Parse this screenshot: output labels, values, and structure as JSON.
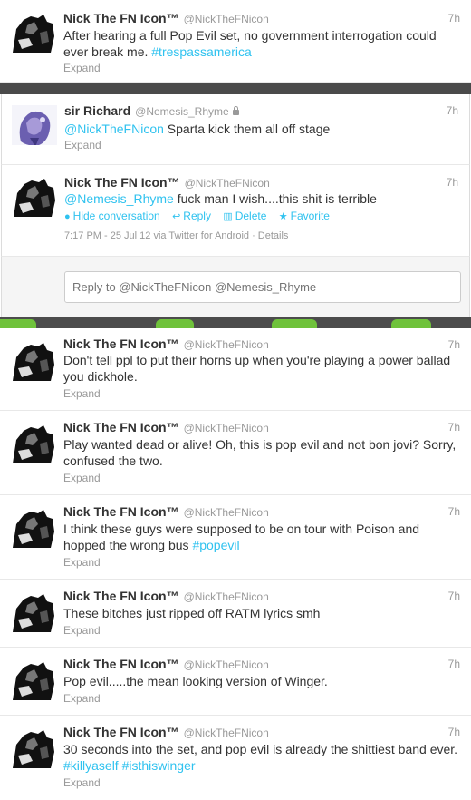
{
  "colors": {
    "link": "#2fc2ef",
    "muted": "#999999",
    "text": "#333333"
  },
  "tweets": [
    {
      "name": "Nick The FN Icon™",
      "handle": "@NickTheFNicon",
      "time": "7h",
      "text": "After hearing a full Pop Evil set, no government interrogation could ever break me. ",
      "tag": "#trespassamerica",
      "expand": "Expand"
    },
    {
      "name": "sir Richard",
      "handle": "@Nemesis_Rhyme",
      "time": "7h",
      "mention": "@NickTheFNicon",
      "text": " Sparta kick them all off stage",
      "expand": "Expand",
      "protected_icon": "lock-icon"
    },
    {
      "name": "Nick The FN Icon™",
      "handle": "@NickTheFNicon",
      "time": "7h",
      "mention": "@Nemesis_Rhyme",
      "text": " fuck man I wish....this shit is terrible",
      "actions": {
        "hide": "Hide conversation",
        "reply": "Reply",
        "delete": "Delete",
        "favorite": "Favorite"
      },
      "meta": "7:17 PM - 25 Jul 12 via Twitter for Android · Details"
    },
    {
      "name": "Nick The FN Icon™",
      "handle": "@NickTheFNicon",
      "time": "7h",
      "text": "Don't tell ppl to put their horns up when you're playing a power ballad you dickhole.",
      "expand": "Expand"
    },
    {
      "name": "Nick The FN Icon™",
      "handle": "@NickTheFNicon",
      "time": "7h",
      "text": "Play wanted dead or alive! Oh, this is pop evil and not bon jovi? Sorry, confused the two.",
      "expand": "Expand"
    },
    {
      "name": "Nick The FN Icon™",
      "handle": "@NickTheFNicon",
      "time": "7h",
      "text": "I think these guys were supposed to be on tour with Poison and hopped the wrong bus ",
      "tag": "#popevil",
      "expand": "Expand"
    },
    {
      "name": "Nick The FN Icon™",
      "handle": "@NickTheFNicon",
      "time": "7h",
      "text": "These bitches just ripped off RATM lyrics smh",
      "expand": "Expand"
    },
    {
      "name": "Nick The FN Icon™",
      "handle": "@NickTheFNicon",
      "time": "7h",
      "text": "Pop evil.....the mean looking version of Winger.",
      "expand": "Expand"
    },
    {
      "name": "Nick The FN Icon™",
      "handle": "@NickTheFNicon",
      "time": "7h",
      "text": "30 seconds into the set, and pop evil is already the shittiest band ever. ",
      "tag1": "#killyaself",
      "tag2": "#isthiswinger",
      "expand": "Expand"
    }
  ],
  "reply_box": {
    "placeholder": "Reply to @NickTheFNicon @Nemesis_Rhyme"
  }
}
